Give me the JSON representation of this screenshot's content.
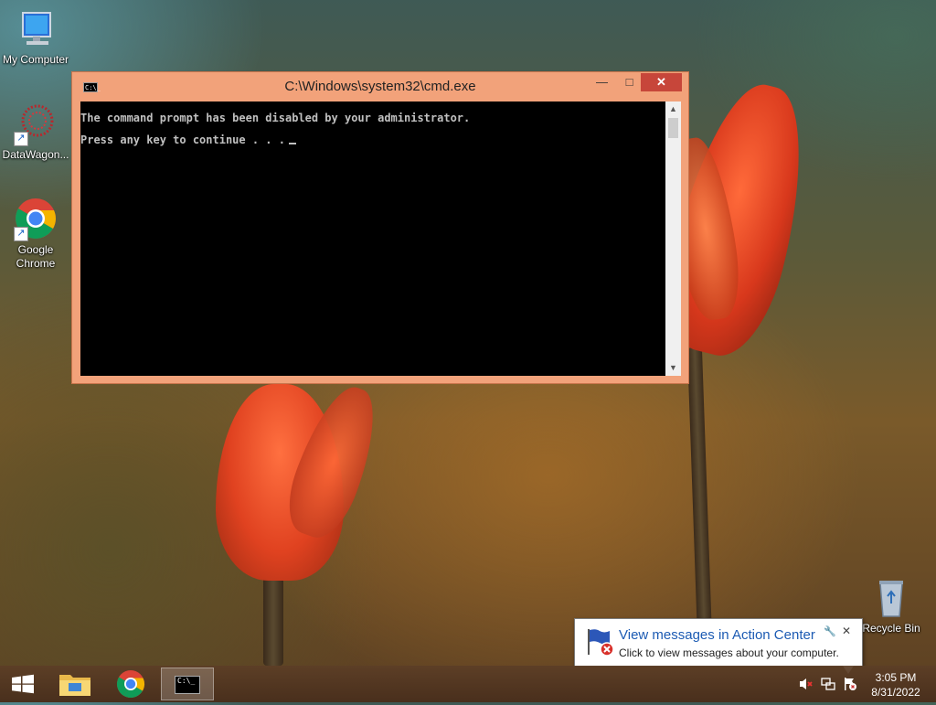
{
  "desktop": {
    "icons": [
      {
        "label": "My Computer"
      },
      {
        "label": "DataWagon..."
      },
      {
        "label_line1": "Google",
        "label_line2": "Chrome"
      },
      {
        "label": "Recycle Bin"
      }
    ]
  },
  "cmd_window": {
    "title": "C:\\Windows\\system32\\cmd.exe",
    "title_icon_text": "C:\\_",
    "lines": [
      "The command prompt has been disabled by your administrator.",
      "Press any key to continue . . ."
    ]
  },
  "notification": {
    "title": "View messages in Action Center",
    "body": "Click to view messages about your computer."
  },
  "taskbar": {
    "cmd_icon_text": "C:\\_",
    "time": "3:05 PM",
    "date": "8/31/2022"
  },
  "colors": {
    "window_frame": "#f2a27a",
    "close_button": "#c7463a",
    "console_bg": "#000000",
    "console_text": "#c0c0c0",
    "notification_title": "#1c5bb3"
  }
}
